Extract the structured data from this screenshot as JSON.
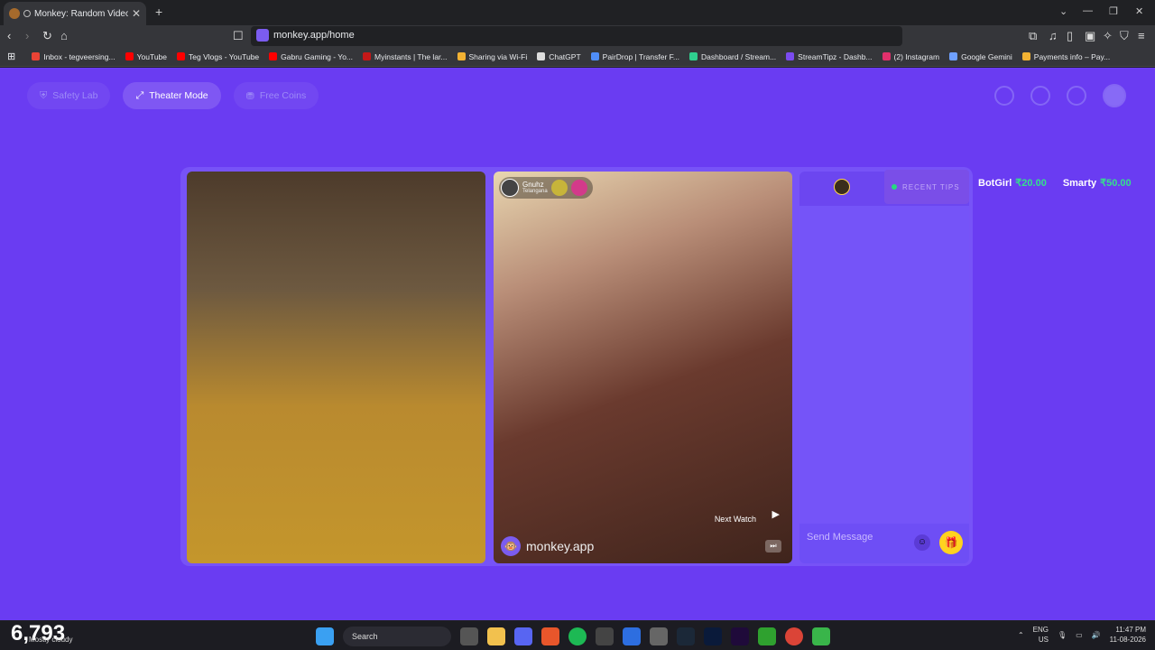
{
  "browser": {
    "tab_title": "Monkey: Random Video Chat",
    "url": "monkey.app/home",
    "bookmarks": [
      {
        "label": "Inbox - tegveersing...",
        "color": "#ea4335"
      },
      {
        "label": "YouTube",
        "color": "#ff0000"
      },
      {
        "label": "Teg Vlogs - YouTube",
        "color": "#ff0000"
      },
      {
        "label": "Gabru Gaming - Yo...",
        "color": "#ff0000"
      },
      {
        "label": "Myinstants | The lar...",
        "color": "#c41818"
      },
      {
        "label": "Sharing via Wi-Fi",
        "color": "#f2b233"
      },
      {
        "label": "ChatGPT",
        "color": "#dddddd"
      },
      {
        "label": "PairDrop | Transfer F...",
        "color": "#4f8ef7"
      },
      {
        "label": "Dashboard / Stream...",
        "color": "#2fcf8f"
      },
      {
        "label": "StreamTipz - Dashb...",
        "color": "#7b4bf0"
      },
      {
        "label": "(2) Instagram",
        "color": "#e1306c"
      },
      {
        "label": "Google Gemini",
        "color": "#6ea0ff"
      },
      {
        "label": "Payments info – Pay...",
        "color": "#f2b233"
      }
    ]
  },
  "nav": {
    "safety_lab": "Safety Lab",
    "theater_mode": "Theater Mode",
    "free_coins": "Free Coins"
  },
  "remote_user": {
    "name": "Gnuhz",
    "location": "Telangana"
  },
  "video": {
    "next_watch": "Next Watch",
    "brand": "monkey.app"
  },
  "chat": {
    "tips_label": "RECENT TIPS",
    "ticker": [
      {
        "name": "BotGirl",
        "amount": "₹20.00"
      },
      {
        "name": "Smarty",
        "amount": "₹50.00"
      }
    ],
    "send_placeholder": "Send Message"
  },
  "taskbar": {
    "counter": "6,793",
    "weather": "Mostly cloudy",
    "search": "Search",
    "lang1": "ENG",
    "lang2": "US",
    "time": "11:47 PM",
    "date": "11-08-2026"
  }
}
